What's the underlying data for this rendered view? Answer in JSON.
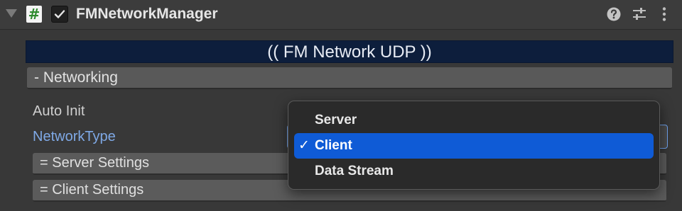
{
  "header": {
    "script_icon": "#",
    "title": "FMNetworkManager",
    "icons": [
      "help-icon",
      "preset-icon",
      "kebab-menu-icon"
    ]
  },
  "banner": {
    "text": "(( FM Network UDP ))"
  },
  "networking_section": {
    "label": "- Networking"
  },
  "properties": {
    "auto_init": {
      "label": "Auto Init"
    },
    "network_type": {
      "label": "NetworkType"
    }
  },
  "subsections": {
    "server_settings": "= Server Settings",
    "client_settings": "= Client Settings"
  },
  "dropdown": {
    "options": [
      {
        "label": "Server",
        "selected": false
      },
      {
        "label": "Client",
        "selected": true,
        "check": "✓"
      },
      {
        "label": "Data Stream",
        "selected": false
      }
    ]
  },
  "colors": {
    "background": "#383838",
    "banner": "#0d1e3c",
    "selected": "#0f5bd6",
    "label_highlight": "#7fa9e6"
  }
}
